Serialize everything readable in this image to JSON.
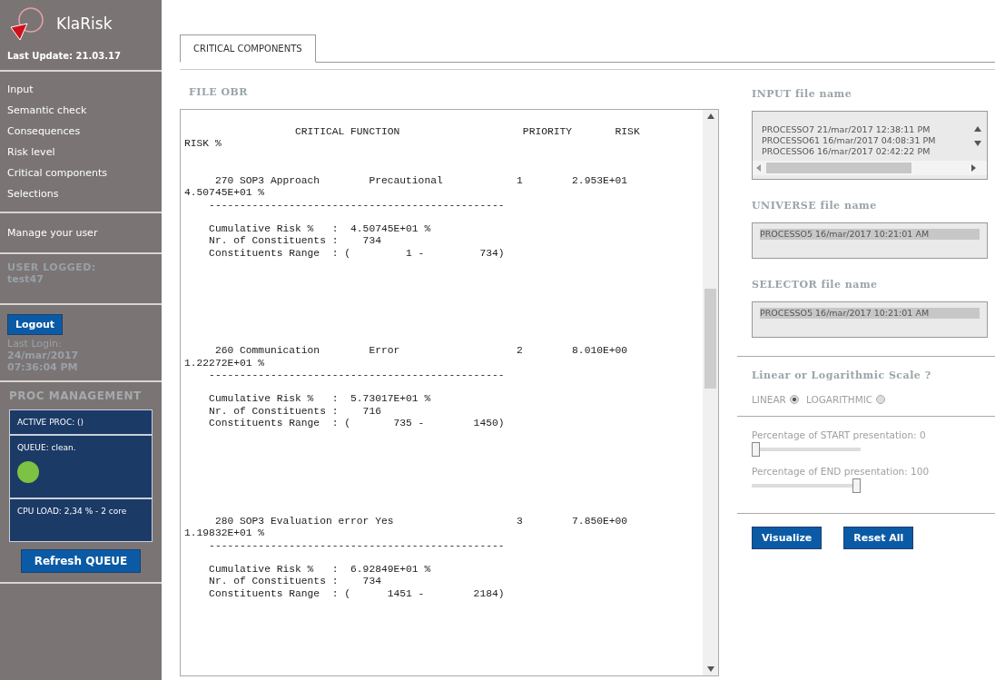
{
  "sidebar": {
    "logo": "KlaRisk",
    "last_update": "Last Update: 21.03.17",
    "menu": [
      {
        "label": "Input"
      },
      {
        "label": "Semantic check"
      },
      {
        "label": "Consequences"
      },
      {
        "label": "Risk level"
      },
      {
        "label": "Critical components"
      },
      {
        "label": "Selections"
      }
    ],
    "manage_user": "Manage your user",
    "user_logged_label": "USER LOGGED:",
    "user_name": "test47",
    "logout_button": "Logout",
    "last_login_label": "Last Login:",
    "last_login_date": "24/mar/2017",
    "last_login_time": "07:36:04 PM",
    "proc_management": {
      "title": "PROC MANAGEMENT",
      "active_proc": "ACTIVE PROC: ()",
      "queue": "QUEUE: clean.",
      "queue_ok": true,
      "cpu_load": "CPU LOAD: 2,34 % - 2 core"
    },
    "refresh_button": "Refresh QUEUE"
  },
  "tabs": [
    {
      "label": "CRITICAL COMPONENTS",
      "selected": true
    }
  ],
  "report": {
    "title": "FILE OBR",
    "header": [
      "                  CRITICAL FUNCTION                    PRIORITY       RISK",
      "RISK %"
    ],
    "entries": [
      {
        "summary": [
          "     270 SOP3 Approach        Precautional            1        2.953E+01",
          "4.50745E+01 %"
        ],
        "separator": "    ------------------------------------------------",
        "details": [
          "    Cumulative Risk %   :  4.50745E+01 %",
          "    Nr. of Constituents :    734",
          "    Constituents Range  : (         1 -         734)"
        ]
      },
      {
        "summary": [
          "     260 Communication        Error                   2        8.010E+00",
          "1.22272E+01 %"
        ],
        "separator": "    ------------------------------------------------",
        "details": [
          "    Cumulative Risk %   :  5.73017E+01 %",
          "    Nr. of Constituents :    716",
          "    Constituents Range  : (       735 -        1450)"
        ]
      },
      {
        "summary": [
          "     280 SOP3 Evaluation error Yes                    3        7.850E+00",
          "1.19832E+01 %"
        ],
        "separator": "    ------------------------------------------------",
        "details": [
          "    Cumulative Risk %   :  6.92849E+01 %",
          "    Nr. of Constituents :    734",
          "    Constituents Range  : (      1451 -        2184)"
        ]
      }
    ]
  },
  "input_file": {
    "label": "INPUT file name",
    "items": [
      {
        "label": "PROCESSO7 21/mar/2017 12:38:11 PM",
        "selected": false
      },
      {
        "label": "PROCESSO61 16/mar/2017 04:08:31 PM",
        "selected": false
      },
      {
        "label": "PROCESSO6 16/mar/2017 02:42:22 PM",
        "selected": false
      }
    ]
  },
  "universe_file": {
    "label": "UNIVERSE file name",
    "items": [
      {
        "label": "PROCESSO5 16/mar/2017 10:21:01 AM",
        "selected": true
      }
    ]
  },
  "selector_file": {
    "label": "SELECTOR file name",
    "items": [
      {
        "label": "PROCESSO5 16/mar/2017 10:21:01 AM",
        "selected": true
      }
    ]
  },
  "scale": {
    "title": "Linear or Logarithmic Scale ?",
    "options": [
      {
        "label": "LINEAR",
        "selected": true
      },
      {
        "label": "LOGARITHMIC",
        "selected": false
      }
    ]
  },
  "sliders": [
    {
      "label": "Percentage of START presentation: 0",
      "level": 0
    },
    {
      "label": "Percentage of END presentation: 100",
      "level": 1
    }
  ],
  "buttons": [
    "Visualize",
    "Reset All"
  ]
}
